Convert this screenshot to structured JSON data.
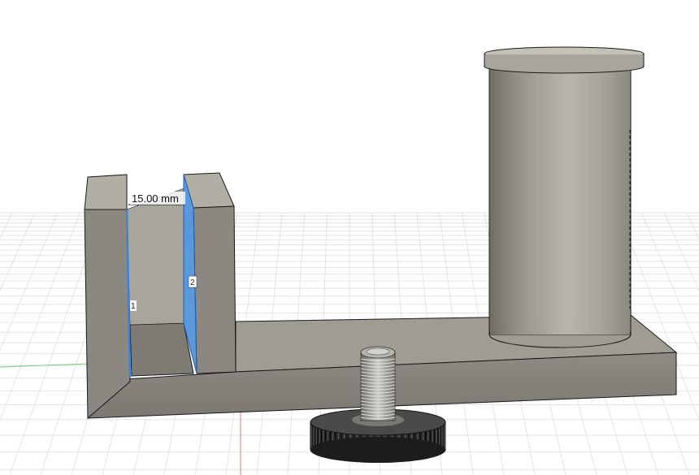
{
  "viewport": {
    "background": "#ffffff",
    "grid_color": "#d9d9d9",
    "axis_x_color": "#e05a5a",
    "axis_z_color": "#6cc06c"
  },
  "model": {
    "body_color": "#8f8d84",
    "body_top_color": "#b9b6aa",
    "edge_color": "#1a1a1a",
    "selection_color": "#3b82d9"
  },
  "measure": {
    "distance_label": "15.00 mm",
    "face_1_label": "1",
    "face_2_label": "2"
  }
}
